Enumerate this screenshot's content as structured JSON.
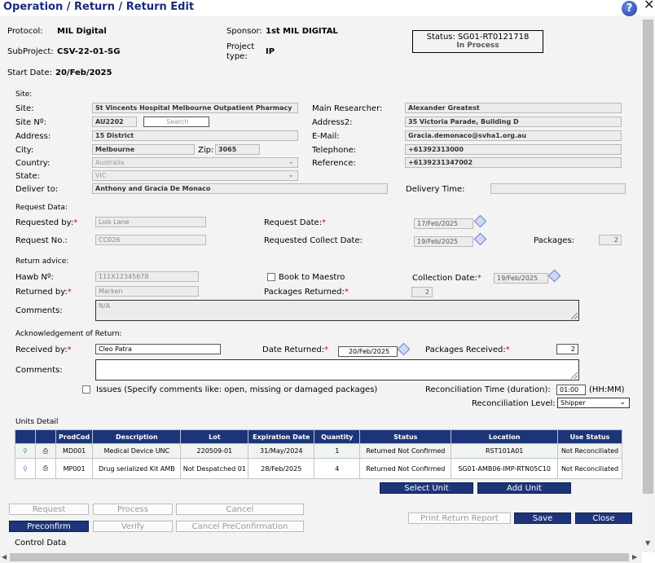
{
  "window": {
    "title": "Operation / Return / Return Edit",
    "help_glyph": "?",
    "close_glyph": "✕"
  },
  "header": {
    "protocol_label": "Protocol:",
    "protocol_value": "MIL Digital",
    "sponsor_label": "Sponsor:",
    "sponsor_value": "1st MIL DIGITAL",
    "subproject_label": "SubProject:",
    "subproject_value": "CSV-22-01-SG",
    "project_type_label_1": "Project",
    "project_type_label_2": "type:",
    "project_type_value": "IP",
    "start_date_label": "Start Date:",
    "start_date_value": "20/Feb/2025",
    "status_line": "Status: SG01-RT0121718",
    "status_sub": "In Process"
  },
  "site": {
    "section": "Site:",
    "site_label": "Site:",
    "site_value": "St Vincents Hospital Melbourne Outpatient Pharmacy",
    "site_no_label": "Site Nº:",
    "site_no_value": "AU2202",
    "search_label": "Search",
    "address_label": "Address:",
    "address_value": "15 District",
    "city_label": "City:",
    "city_value": "Melbourne",
    "zip_label": "Zip:",
    "zip_value": "3065",
    "country_label": "Country:",
    "country_value": "Australia",
    "state_label": "State:",
    "state_value": "VIC",
    "deliver_label": "Deliver to:",
    "deliver_value": "Anthony and Gracia De Monaco",
    "main_researcher_label": "Main Researcher:",
    "main_researcher_value": "Alexander Greatest",
    "address2_label": "Address2:",
    "address2_value": "35 Victoria Parade, Building D",
    "email_label": "E-Mail:",
    "email_value": "Gracia.demonaco@svha1.org.au",
    "telephone_label": "Telephone:",
    "telephone_value": "+61392313000",
    "reference_label": "Reference:",
    "reference_value": "+6139231347002",
    "delivery_time_label": "Delivery Time:",
    "delivery_time_value": ""
  },
  "request": {
    "section": "Request Data:",
    "requested_by_label": "Requested by:",
    "requested_by_value": "Lois Lane",
    "request_no_label": "Request No.:",
    "request_no_value": "CC026",
    "request_date_label": "Request Date:",
    "request_date_value": "17/Feb/2025",
    "collect_date_label": "Requested Collect Date:",
    "collect_date_value": "19/Feb/2025",
    "packages_label": "Packages:",
    "packages_value": "2"
  },
  "return_advice": {
    "section": "Return advice:",
    "hawb_label": "Hawb Nº:",
    "hawb_value": "111X12345678",
    "book_label": "Book to Maestro",
    "collection_date_label": "Collection Date:",
    "collection_date_value": "19/Feb/2025",
    "returned_by_label": "Returned by:",
    "returned_by_value": "Marken",
    "packages_returned_label": "Packages Returned:",
    "packages_returned_value": "2",
    "comments_label": "Comments:",
    "comments_value": "N/A"
  },
  "acknowledgement": {
    "section": "Acknowledgement of Return:",
    "received_by_label": "Received by:",
    "received_by_value": "Cleo Patra",
    "date_returned_label": "Date Returned:",
    "date_returned_value": "20/Feb/2025",
    "packages_received_label": "Packages Received:",
    "packages_received_value": "2",
    "comments_label": "Comments:",
    "comments_value": "",
    "issues_label": "Issues (Specify comments like: open, missing or damaged packages)",
    "recon_time_label": "Reconciliation Time (duration):",
    "recon_time_value": "01:00",
    "recon_time_unit": "(HH:MM)",
    "recon_level_label": "Reconciliation Level:",
    "recon_level_value": "Shipper"
  },
  "units": {
    "section": "Units Detail",
    "columns": [
      "ProdCod",
      "Description",
      "Lot",
      "Expiration Date",
      "Quantity",
      "Status",
      "Location",
      "Use Status"
    ],
    "rows": [
      {
        "prodcod": "MD001",
        "description": "Medical Device UNC",
        "lot": "220509-01",
        "expiration": "31/May/2024",
        "quantity": "1",
        "status": "Returned Not Confirmed",
        "location": "RST101A01",
        "use_status": "Not Reconciliated"
      },
      {
        "prodcod": "MP001",
        "description": "Drug serialized Kit AMB",
        "lot": "Not Despatched 01",
        "expiration": "28/Feb/2025",
        "quantity": "4",
        "status": "Returned Not Confirmed",
        "location": "SG01-AMB06-IMP-RTN05C10",
        "use_status": "Not Reconciliated"
      }
    ],
    "select_unit": "Select Unit",
    "add_unit": "Add Unit"
  },
  "actions": {
    "request": "Request",
    "process": "Process",
    "cancel": "Cancel",
    "preconfirm": "Preconfirm",
    "verify": "Verify",
    "cancel_preconfirmation": "Cancel PreConfirmation",
    "print_return_report": "Print Return Report",
    "save": "Save",
    "close": "Close"
  },
  "footer": {
    "control_data": "Control Data"
  },
  "colors": {
    "accent": "#1d3578",
    "title": "#1a2b7a",
    "required": "#dd0000",
    "panel": "#f3f3f3"
  }
}
